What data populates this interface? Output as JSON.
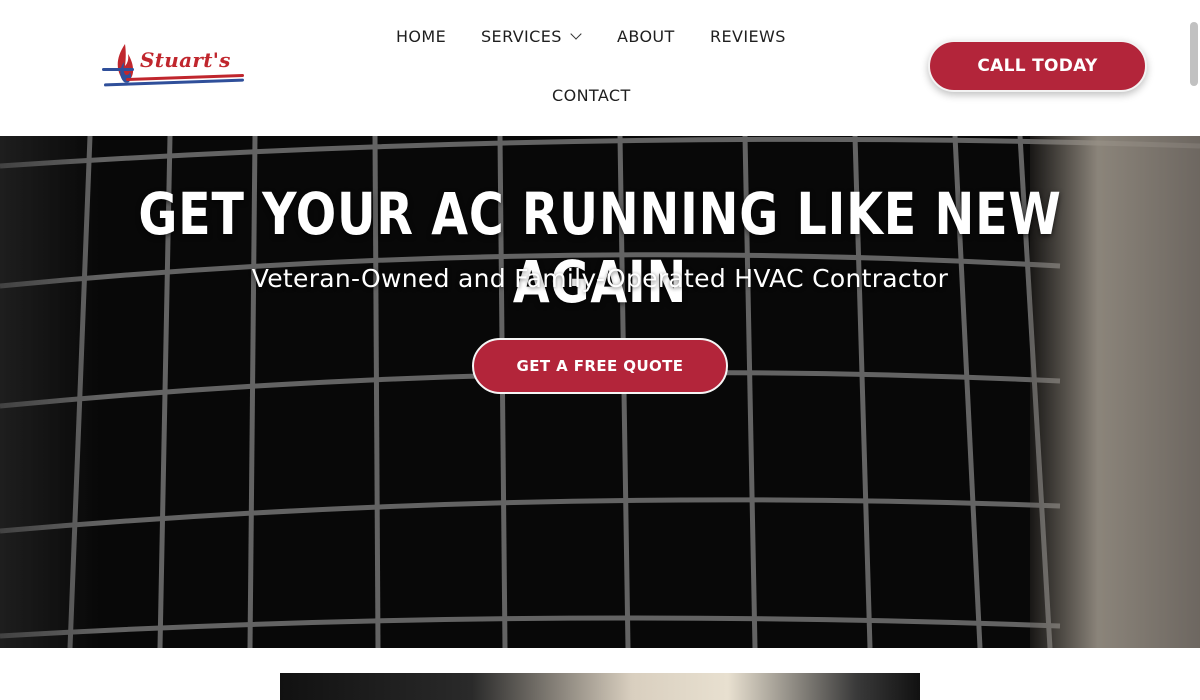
{
  "brand": {
    "logo_text": "Stuart's"
  },
  "nav": {
    "items": [
      {
        "label": "HOME"
      },
      {
        "label": "SERVICES"
      },
      {
        "label": "ABOUT"
      },
      {
        "label": "REVIEWS"
      },
      {
        "label": "CONTACT"
      }
    ],
    "cta_label": "CALL TODAY"
  },
  "hero": {
    "title": "GET YOUR AC RUNNING LIKE NEW AGAIN",
    "subtitle": "Veteran-Owned and Family-Operated HVAC Contractor",
    "cta_label": "GET A FREE QUOTE"
  },
  "colors": {
    "accent": "#b3253a",
    "logo_red": "#c0262d",
    "logo_blue": "#2f4f9a",
    "text_dark": "#1f1f1f"
  },
  "icons": {
    "services_dropdown": "chevron-down-icon",
    "logo_mark": "flame-icon"
  }
}
